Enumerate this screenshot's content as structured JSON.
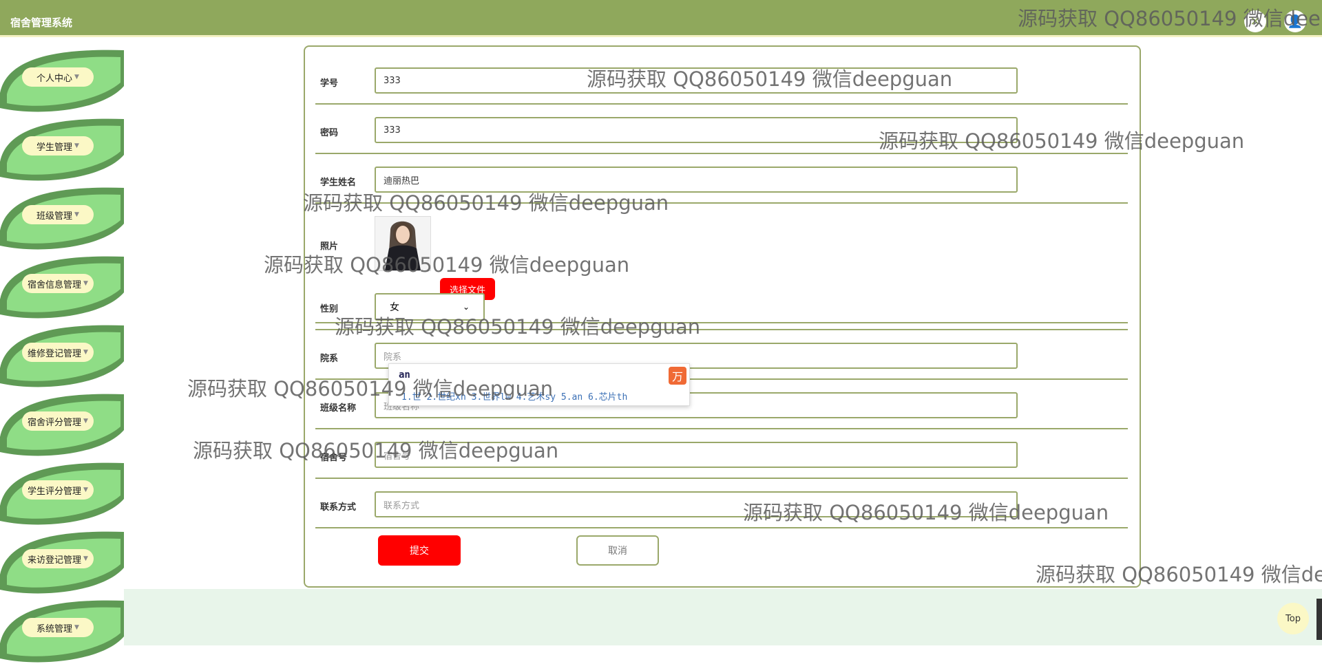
{
  "app": {
    "title": "宿舍管理系统"
  },
  "sidebar": {
    "items": [
      {
        "label": "个人中心"
      },
      {
        "label": "学生管理"
      },
      {
        "label": "班级管理"
      },
      {
        "label": "宿舍信息管理"
      },
      {
        "label": "维修登记管理"
      },
      {
        "label": "宿舍评分管理"
      },
      {
        "label": "学生评分管理"
      },
      {
        "label": "来访登记管理"
      },
      {
        "label": "系统管理"
      }
    ]
  },
  "form": {
    "student_id": {
      "label": "学号",
      "value": "333"
    },
    "password": {
      "label": "密码",
      "value": "333"
    },
    "name": {
      "label": "学生姓名",
      "value": "迪丽热巴"
    },
    "photo": {
      "label": "照片",
      "button": "选择文件"
    },
    "gender": {
      "label": "性别",
      "value": "女"
    },
    "department": {
      "label": "院系",
      "placeholder": "院系"
    },
    "class_name": {
      "label": "班级名称",
      "placeholder": "班级名称"
    },
    "dorm": {
      "label": "宿舍号",
      "placeholder": "宿舍号"
    },
    "contact": {
      "label": "联系方式",
      "placeholder": "联系方式"
    },
    "submit": "提交",
    "cancel": "取消"
  },
  "ime": {
    "pinyin": "an",
    "candidates": "1.世 2.世纪xn 3.世界lw 4.艺术sy 5.an 6.芯片th",
    "logo": "万"
  },
  "watermark": "源码获取 QQ86050149 微信deepguan",
  "top_button": "Top",
  "icons": {
    "close": "close-icon",
    "user": "user-icon"
  }
}
